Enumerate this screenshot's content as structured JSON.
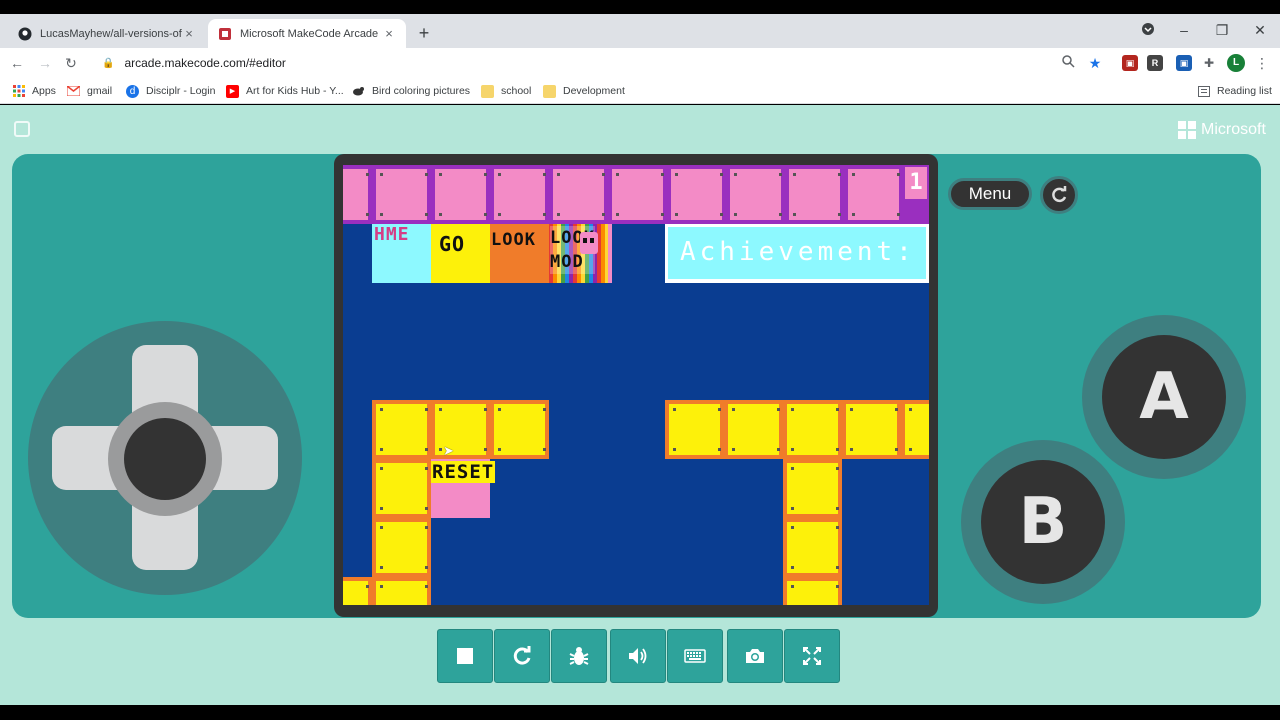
{
  "browser": {
    "tabs": [
      {
        "title": "LucasMayhew/all-versions-of-Fal",
        "close": "×"
      },
      {
        "title": "Microsoft MakeCode Arcade",
        "close": "×"
      }
    ],
    "new_tab": "+",
    "window_controls": {
      "minimize": "–",
      "maximize": "❐",
      "close": "✕"
    },
    "url": "arcade.makecode.com/#editor",
    "nav": {
      "back": "←",
      "forward": "→",
      "reload": "↻"
    },
    "profile_initial": "L",
    "reading_list": "Reading list",
    "bookmarks": [
      {
        "label": "Apps",
        "icon": "apps-grid-icon"
      },
      {
        "label": "gmail",
        "icon": "gmail-icon"
      },
      {
        "label": "Disciplr - Login",
        "icon": "disciplr-icon"
      },
      {
        "label": "Art for Kids Hub - Y...",
        "icon": "youtube-icon"
      },
      {
        "label": "Bird coloring pictures",
        "icon": "bird-icon"
      },
      {
        "label": "school",
        "icon": "folder-icon"
      },
      {
        "label": "Development",
        "icon": "folder-icon"
      }
    ]
  },
  "makecode": {
    "brand": "Microsoft",
    "menu_label": "Menu",
    "button_a": "A",
    "button_b": "B",
    "game": {
      "counter": "1",
      "labels": {
        "home": "HME",
        "go": "GO",
        "look": "LOOK",
        "look_mode_line1": "LOOK",
        "look_mode_line2": "MOD",
        "achievements": "Achievement:",
        "reset": "RESET"
      }
    },
    "toolbar_buttons": [
      "stop-icon",
      "restart-icon",
      "debug-icon",
      "sound-icon",
      "keyboard-icon",
      "screenshot-icon",
      "fullscreen-icon"
    ]
  },
  "colors": {
    "page_bg": "#b4e6d9",
    "console": "#2ea39b",
    "game_bg": "#0a3d91",
    "pink_tile": "#f38bc6",
    "yellow_tile": "#fdf10a"
  }
}
